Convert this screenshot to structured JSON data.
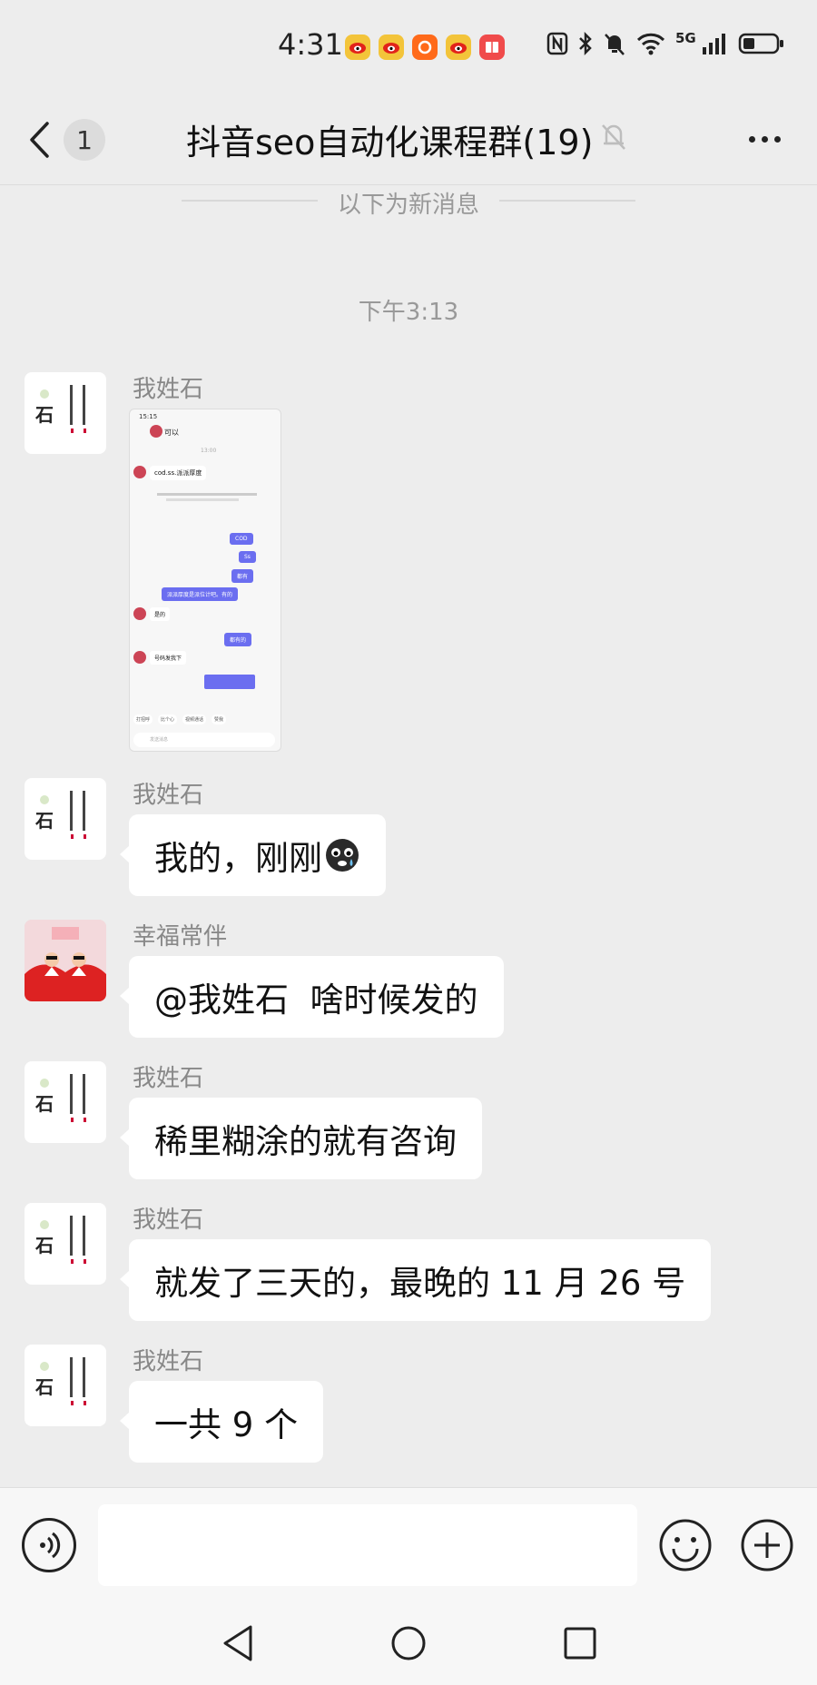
{
  "status_bar": {
    "time": "4:31",
    "network": "5G",
    "notification_icons": [
      "weibo-icon",
      "weibo-icon",
      "taobao-icon",
      "weibo-icon",
      "book-icon"
    ]
  },
  "header": {
    "unread_count": "1",
    "title": "抖音seo自动化课程群(19)"
  },
  "chat": {
    "new_messages_divider": "以下为新消息",
    "timestamp": "下午3:13",
    "messages": [
      {
        "sender": "我姓石",
        "type": "image"
      },
      {
        "sender": "我姓石",
        "text": "我的，刚刚"
      },
      {
        "sender": "幸福常伴",
        "text": "@我姓石  啥时候发的"
      },
      {
        "sender": "我姓石",
        "text": "稀里糊涂的就有咨询"
      },
      {
        "sender": "我姓石",
        "text": "就发了三天的，最晚的 11 月 26 号"
      },
      {
        "sender": "我姓石",
        "text": "一共 9 个"
      }
    ]
  },
  "shared_image": {
    "time": "15:15",
    "contact": "可以",
    "chat_time": "13:00",
    "lines": [
      "cod.ss.派派厚度",
      "COD",
      "Ss",
      "都有",
      "派派厚度是派位计吧。有的",
      "是的",
      "都有的",
      "号码发我下"
    ],
    "quick_actions": [
      "打招呼",
      "比个心",
      "视频通话",
      "赞我"
    ],
    "input_placeholder": "发送消息"
  },
  "colors": {
    "background": "#ededed",
    "bubble": "#ffffff",
    "sender": "#888888",
    "accent_purple": "#6b6ef0"
  }
}
